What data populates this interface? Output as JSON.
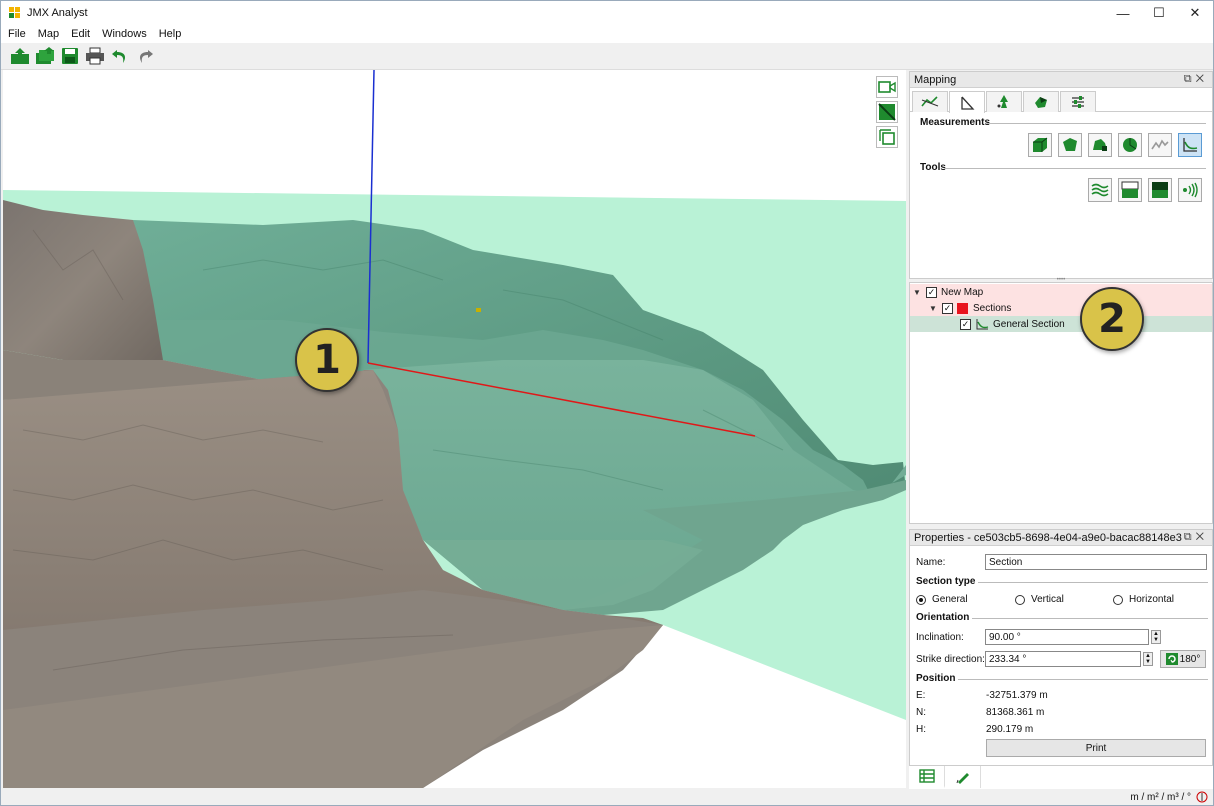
{
  "app": {
    "title": "JMX Analyst"
  },
  "window_controls": {
    "minimize": "—",
    "maximize": "☐",
    "close": "✕"
  },
  "menu": [
    "File",
    "Map",
    "Edit",
    "Windows",
    "Help"
  ],
  "toolbar_icons": [
    "new-map-icon",
    "open-icon",
    "save-icon",
    "print-icon",
    "undo-icon",
    "redo-icon"
  ],
  "viewport": {
    "tools": [
      "camera-icon",
      "section-view-icon",
      "frame-icon"
    ],
    "markers": {
      "m1": "1",
      "m2": "2"
    }
  },
  "mapping_panel": {
    "title": "Mapping",
    "tabs": [
      "line-tools-tab",
      "measurement-tab",
      "points-tab",
      "volume-tab",
      "settings-tab"
    ],
    "measurements_label": "Measurements",
    "measurement_buttons": [
      "cube-volume-icon",
      "polygon-icon",
      "stockpile-icon",
      "sphere-icon",
      "profile-line-icon",
      "section-icon"
    ],
    "tools_label": "Tools",
    "tool_buttons": [
      "layers-icon",
      "cut-below-icon",
      "cut-above-icon",
      "signal-icon"
    ]
  },
  "tree": {
    "root": "New Map",
    "group": "Sections",
    "item": "General Section"
  },
  "properties": {
    "title": "Properties - ce503cb5-8698-4e04-a9e0-bacac88148e3",
    "name_label": "Name:",
    "name_value": "Section",
    "section_type_label": "Section type",
    "type_general": "General",
    "type_vertical": "Vertical",
    "type_horizontal": "Horizontal",
    "selected_type": "General",
    "orientation_label": "Orientation",
    "inclination_label": "Inclination:",
    "inclination_value": "90.00 °",
    "strike_label": "Strike direction:",
    "strike_value": "233.34 °",
    "flip_label": "180°",
    "position_label": "Position",
    "e_label": "E:",
    "e_value": "-32751.379 m",
    "n_label": "N:",
    "n_value": "81368.361 m",
    "h_label": "H:",
    "h_value": "290.179 m",
    "print_label": "Print"
  },
  "status": {
    "units": "m / m² / m³ / °"
  },
  "colors": {
    "accent_green": "#1f8a2e",
    "section_plane": "#b9f2d6",
    "sections_red": "#e8141e",
    "marker_yellow": "#d9c349"
  }
}
